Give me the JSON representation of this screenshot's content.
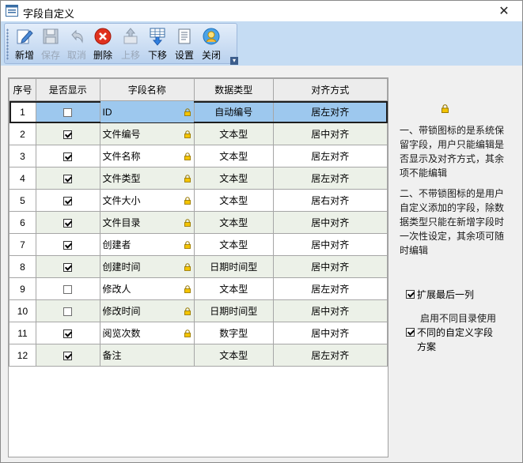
{
  "window": {
    "title": "字段自定义",
    "close_glyph": "✕"
  },
  "toolbar": {
    "buttons": [
      {
        "label": "新增",
        "icon": "new-pencil-icon",
        "enabled": true
      },
      {
        "label": "保存",
        "icon": "save-disk-icon",
        "enabled": false
      },
      {
        "label": "取消",
        "icon": "undo-icon",
        "enabled": false
      },
      {
        "label": "删除",
        "icon": "delete-x-icon",
        "enabled": true
      },
      {
        "label": "上移",
        "icon": "move-up-icon",
        "enabled": false
      },
      {
        "label": "下移",
        "icon": "move-down-icon",
        "enabled": true
      },
      {
        "label": "设置",
        "icon": "settings-doc-icon",
        "enabled": true
      },
      {
        "label": "关闭",
        "icon": "close-exit-icon",
        "enabled": true
      }
    ]
  },
  "grid": {
    "headers": [
      "序号",
      "是否显示",
      "字段名称",
      "数据类型",
      "对齐方式"
    ],
    "rows": [
      {
        "seq": "1",
        "show": false,
        "name": "ID",
        "locked": true,
        "type": "自动编号",
        "align": "居左对齐",
        "selected": true
      },
      {
        "seq": "2",
        "show": true,
        "name": "文件编号",
        "locked": true,
        "type": "文本型",
        "align": "居中对齐"
      },
      {
        "seq": "3",
        "show": true,
        "name": "文件名称",
        "locked": true,
        "type": "文本型",
        "align": "居左对齐"
      },
      {
        "seq": "4",
        "show": true,
        "name": "文件类型",
        "locked": true,
        "type": "文本型",
        "align": "居左对齐"
      },
      {
        "seq": "5",
        "show": true,
        "name": "文件大小",
        "locked": true,
        "type": "文本型",
        "align": "居右对齐"
      },
      {
        "seq": "6",
        "show": true,
        "name": "文件目录",
        "locked": true,
        "type": "文本型",
        "align": "居中对齐"
      },
      {
        "seq": "7",
        "show": true,
        "name": "创建者",
        "locked": true,
        "type": "文本型",
        "align": "居中对齐"
      },
      {
        "seq": "8",
        "show": true,
        "name": "创建时间",
        "locked": true,
        "type": "日期时间型",
        "align": "居中对齐"
      },
      {
        "seq": "9",
        "show": false,
        "name": "修改人",
        "locked": true,
        "type": "文本型",
        "align": "居左对齐"
      },
      {
        "seq": "10",
        "show": false,
        "name": "修改时间",
        "locked": true,
        "type": "日期时间型",
        "align": "居中对齐"
      },
      {
        "seq": "11",
        "show": true,
        "name": "阅览次数",
        "locked": true,
        "type": "数字型",
        "align": "居中对齐"
      },
      {
        "seq": "12",
        "show": true,
        "name": "备注",
        "locked": false,
        "type": "文本型",
        "align": "居左对齐"
      }
    ]
  },
  "notes": {
    "note1": "一、带锁图标的是系统保留字段，用户只能编辑是否显示及对齐方式，其余项不能编辑",
    "note2": "二、不带锁图标的是用户自定义添加的字段，除数据类型只能在新增字段时一次性设定，其余项可随时编辑"
  },
  "options": {
    "extend_last_column": {
      "label": "扩展最后一列",
      "checked": true
    },
    "different_scheme": {
      "label_top": "启用不同目录使用",
      "label": "不同的自定义字段方案",
      "checked": true
    }
  },
  "colors": {
    "toolbar_bg": "#c5dcf3",
    "selected_row": "#9dc8ee",
    "alt_row": "#ecf1e8",
    "lock": "#e6b800"
  }
}
